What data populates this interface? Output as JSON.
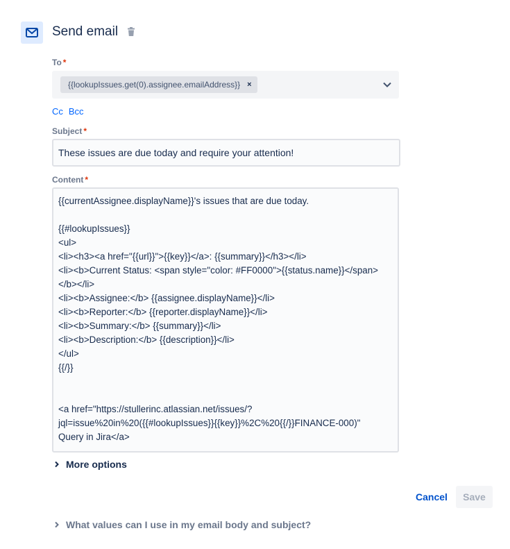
{
  "header": {
    "title": "Send email",
    "icon": "mail-icon",
    "delete_icon": "trash-icon"
  },
  "to": {
    "label": "To",
    "required_mark": "*",
    "chips": [
      {
        "value": "{{lookupIssues.get(0).assignee.emailAddress}}",
        "remove": "×"
      }
    ]
  },
  "cc_label": "Cc",
  "bcc_label": "Bcc",
  "subject": {
    "label": "Subject",
    "required_mark": "*",
    "value": "These issues are due today and require your attention!"
  },
  "content": {
    "label": "Content",
    "required_mark": "*",
    "lines": [
      "{{currentAssignee.displayName}}'s issues that are due today.",
      "",
      "{{#lookupIssues}}",
      "<ul>",
      "<li><h3><a href=\"{{url}}\">{{key}}</a>: {{summary}}</h3></li>",
      "<li><b>Current Status: <span style=\"color: #FF0000\">{{status.name}}</span>",
      "</b></li>",
      "<li><b>Assignee:</b> {{assignee.displayName}}</li>",
      "<li><b>Reporter:</b> {{reporter.displayName}}</li>",
      "<li><b>Summary:</b> {{summary}}</li>",
      "<li><b>Description:</b> {{description}}</li>",
      "</ul>",
      "{{/}}",
      "",
      "",
      "<a href=\"https://stullerinc.atlassian.net/issues/?",
      "jql=issue%20in%20({{#lookupIssues}}{{key}}%2C%20{{/}}FINANCE-000)\"",
      "Query in Jira</a>"
    ]
  },
  "more_options": "More options",
  "actions": {
    "cancel": "Cancel",
    "save": "Save"
  },
  "help": "What values can I use in my email body and subject?"
}
